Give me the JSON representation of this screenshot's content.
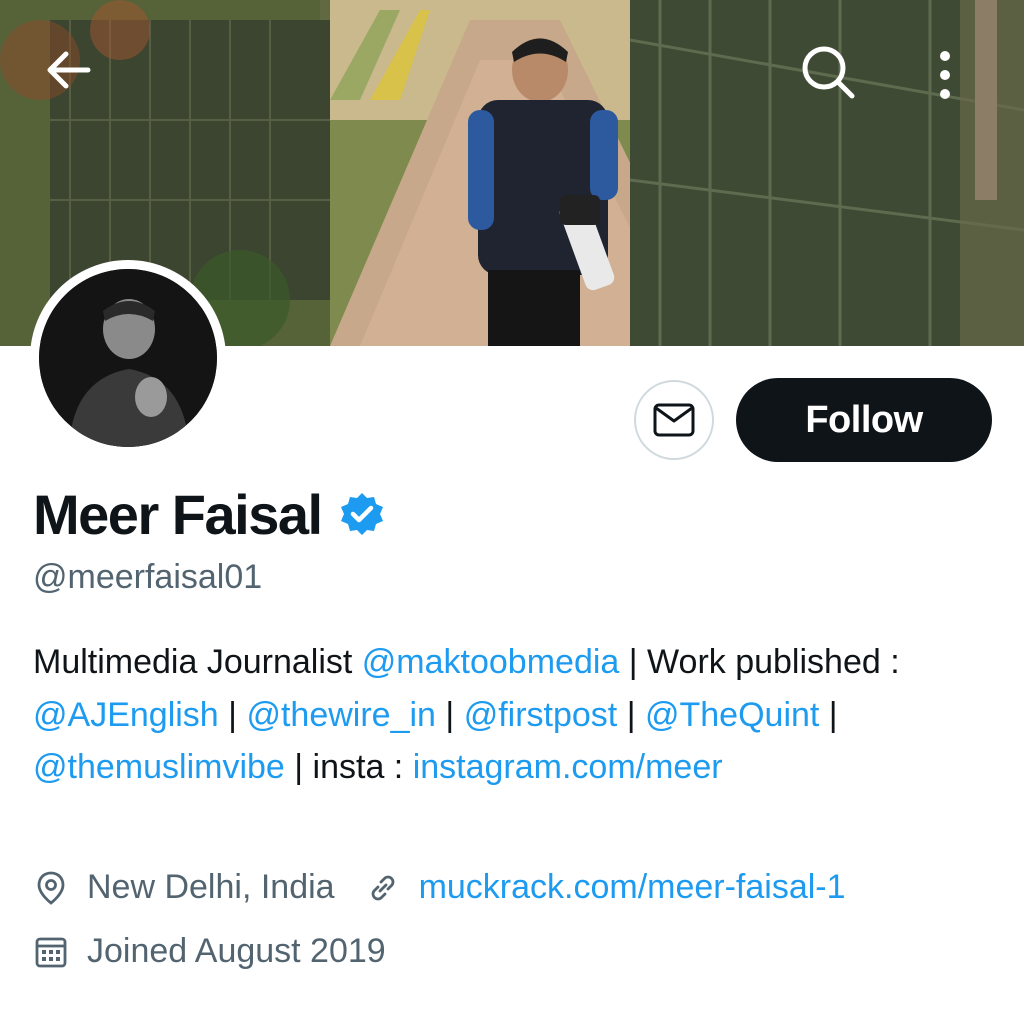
{
  "header": {
    "back_icon": "arrow-left-icon",
    "search_icon": "search-icon",
    "more_icon": "more-vertical-icon"
  },
  "profile": {
    "name": "Meer Faisal",
    "handle": "@meerfaisal01",
    "verified": true,
    "follow_label": "Follow",
    "message_icon": "envelope-icon",
    "bio": {
      "t1": "Multimedia Journalist ",
      "m1": "@maktoobmedia",
      "t2": " | Work published : ",
      "m2": "@AJEnglish",
      "t3": " | ",
      "m3": "@thewire_in",
      "t4": " |  ",
      "m4": "@firstpost",
      "t5": " | ",
      "m5": "@TheQuint",
      "t6": " | ",
      "m6": "@themuslimvibe",
      "t7": " |  insta : ",
      "m7": "instagram.com/meer"
    },
    "location": "New Delhi, India",
    "website": "muckrack.com/meer-faisal-1",
    "joined": "Joined August 2019"
  },
  "colors": {
    "accent": "#1d9bf0",
    "text": "#0f1419",
    "secondary": "#536471",
    "button_dark": "#0f1419"
  }
}
